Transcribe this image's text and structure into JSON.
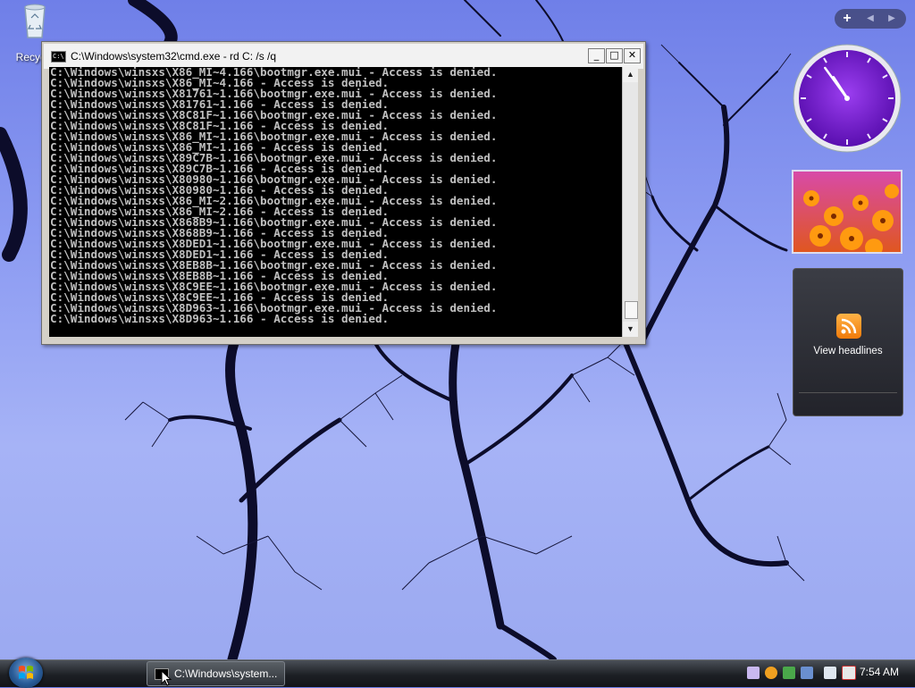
{
  "desktop": {
    "recycle_bin_label": "Recycle",
    "recycle_bin_icon": "recycle-bin-icon"
  },
  "cmd_window": {
    "title": "C:\\Windows\\system32\\cmd.exe - rd  C: /s /q",
    "icon_text": "C:\\",
    "controls": {
      "minimize": "_",
      "maximize": "□",
      "close": "✕"
    },
    "lines": [
      "C:\\Windows\\winsxs\\X86_MI~4.166\\bootmgr.exe.mui - Access is denied.",
      "C:\\Windows\\winsxs\\X86_MI~4.166 - Access is denied.",
      "C:\\Windows\\winsxs\\X81761~1.166\\bootmgr.exe.mui - Access is denied.",
      "C:\\Windows\\winsxs\\X81761~1.166 - Access is denied.",
      "C:\\Windows\\winsxs\\X8C81F~1.166\\bootmgr.exe.mui - Access is denied.",
      "C:\\Windows\\winsxs\\X8C81F~1.166 - Access is denied.",
      "C:\\Windows\\winsxs\\X86_MI~1.166\\bootmgr.exe.mui - Access is denied.",
      "C:\\Windows\\winsxs\\X86_MI~1.166 - Access is denied.",
      "C:\\Windows\\winsxs\\X89C7B~1.166\\bootmgr.exe.mui - Access is denied.",
      "C:\\Windows\\winsxs\\X89C7B~1.166 - Access is denied.",
      "C:\\Windows\\winsxs\\X80980~1.166\\bootmgr.exe.mui - Access is denied.",
      "C:\\Windows\\winsxs\\X80980~1.166 - Access is denied.",
      "C:\\Windows\\winsxs\\X86_MI~2.166\\bootmgr.exe.mui - Access is denied.",
      "C:\\Windows\\winsxs\\X86_MI~2.166 - Access is denied.",
      "C:\\Windows\\winsxs\\X868B9~1.166\\bootmgr.exe.mui - Access is denied.",
      "C:\\Windows\\winsxs\\X868B9~1.166 - Access is denied.",
      "C:\\Windows\\winsxs\\X8DED1~1.166\\bootmgr.exe.mui - Access is denied.",
      "C:\\Windows\\winsxs\\X8DED1~1.166 - Access is denied.",
      "C:\\Windows\\winsxs\\X8EB8B~1.166\\bootmgr.exe.mui - Access is denied.",
      "C:\\Windows\\winsxs\\X8EB8B~1.166 - Access is denied.",
      "C:\\Windows\\winsxs\\X8C9EE~1.166\\bootmgr.exe.mui - Access is denied.",
      "C:\\Windows\\winsxs\\X8C9EE~1.166 - Access is denied.",
      "C:\\Windows\\winsxs\\X8D963~1.166\\bootmgr.exe.mui - Access is denied.",
      "C:\\Windows\\winsxs\\X8D963~1.166 - Access is denied."
    ],
    "colors": {
      "console_bg": "#000000",
      "console_text": "#c0c0c0"
    }
  },
  "sidebar": {
    "add_label": "+",
    "prev_icon": "chevron-left-icon",
    "next_icon": "chevron-right-icon",
    "clock": {
      "hour": 10,
      "minute": 54,
      "face_color": "#7b1fd6"
    },
    "slideshow_icon": "flower-photo",
    "feed": {
      "label": "View headlines",
      "icon": "rss-feed-icon"
    }
  },
  "taskbar": {
    "start_icon": "windows-logo-icon",
    "task_label": "C:\\Windows\\system...",
    "tray_icons": [
      "network-icon",
      "security-alert-icon",
      "update-icon",
      "windows-defender-icon",
      "monitor-icon",
      "volume-muted-icon"
    ],
    "clock_text": "7:54 AM"
  }
}
